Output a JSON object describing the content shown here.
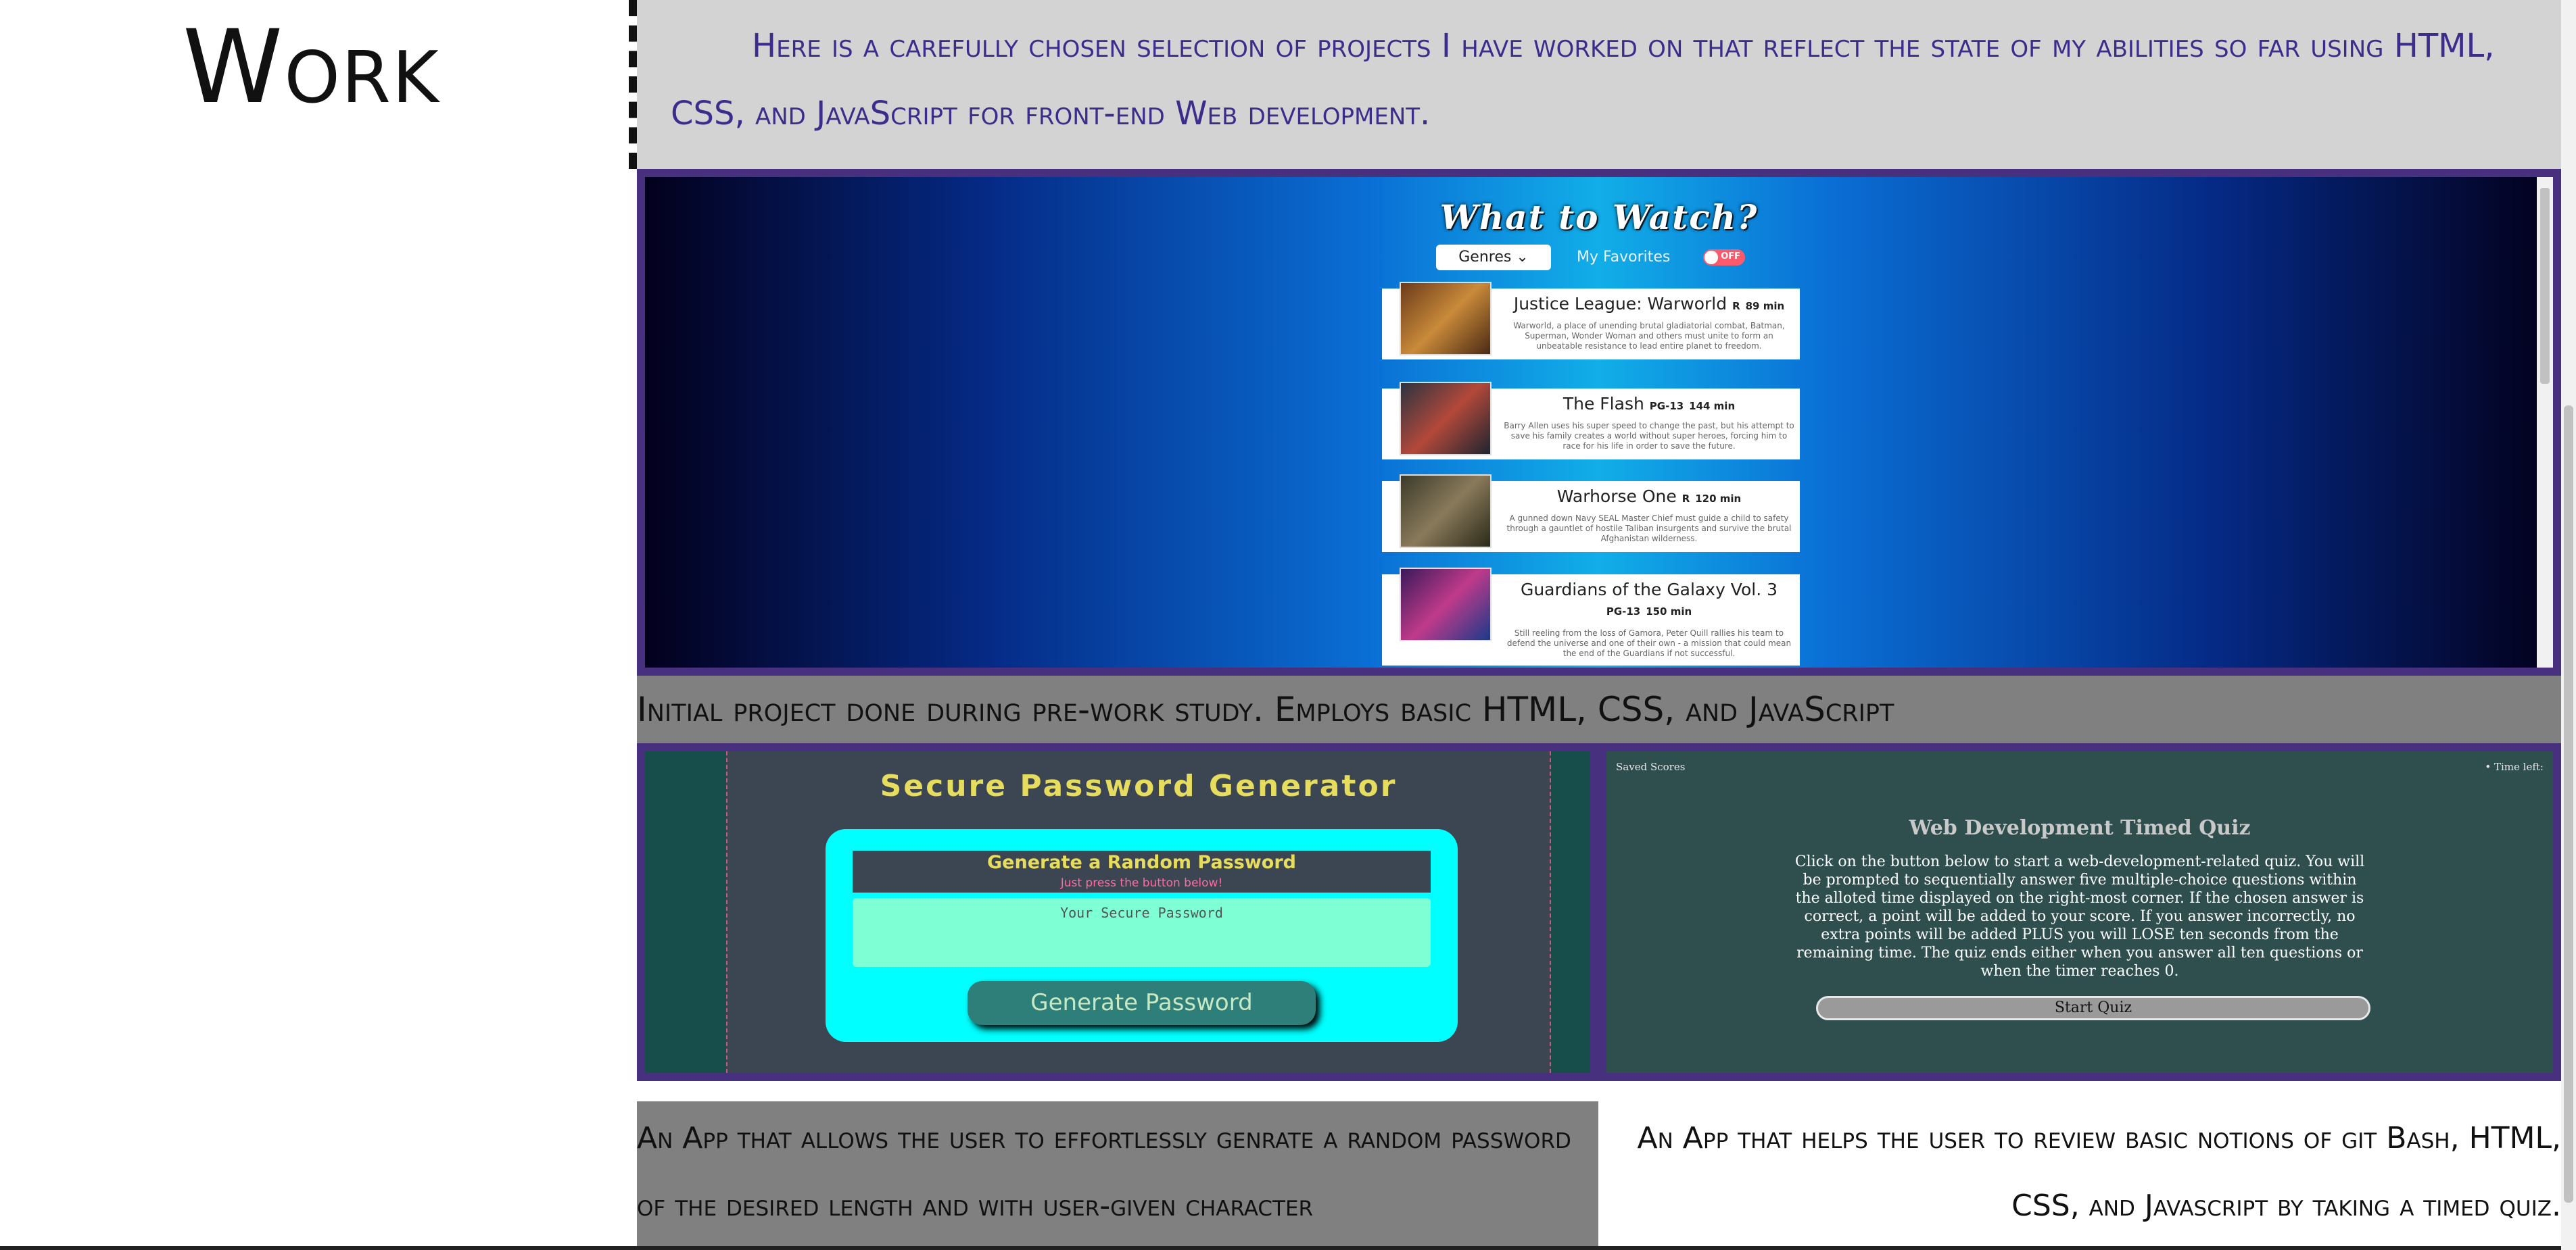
{
  "section": {
    "title": "Work"
  },
  "intro": {
    "text": "Here is a carefully chosen selection of projects I have worked on that reflect the state of my abilities so far using HTML, CSS, and JavaScript for front-end Web development."
  },
  "projects": {
    "watch": {
      "app_title": "What to Watch?",
      "genres_label": "Genres ⌄",
      "favorites_label": "My Favorites",
      "toggle_text": "OFF",
      "movies": [
        {
          "title": "Justice League: Warworld",
          "rating": "R",
          "runtime": "89 min",
          "description": "Warworld, a place of unending brutal gladiatorial combat, Batman, Superman, Wonder Woman and others must unite to form an unbeatable resistance to lead entire planet to freedom."
        },
        {
          "title": "The Flash",
          "rating": "PG-13",
          "runtime": "144 min",
          "description": "Barry Allen uses his super speed to change the past, but his attempt to save his family creates a world without super heroes, forcing him to race for his life in order to save the future."
        },
        {
          "title": "Warhorse One",
          "rating": "R",
          "runtime": "120 min",
          "description": "A gunned down Navy SEAL Master Chief must guide a child to safety through a gauntlet of hostile Taliban insurgents and survive the brutal Afghanistan wilderness."
        },
        {
          "title": "Guardians of the Galaxy Vol. 3",
          "rating": "PG-13",
          "runtime": "150 min",
          "description": "Still reeling from the loss of Gamora, Peter Quill rallies his team to defend the universe and one of their own - a mission that could mean the end of the Guardians if not successful."
        }
      ],
      "caption": "Initial project done during pre-work study. Employs basic HTML, CSS, and JavaScript"
    },
    "password": {
      "title": "Secure Password Generator",
      "card_heading": "Generate a Random Password",
      "card_sub": "Just press the button below!",
      "placeholder": "Your Secure Password",
      "button_label": "Generate Password",
      "caption": "An App that allows the user to effortlessly genrate a random password of the desired length and with user-given character"
    },
    "quiz": {
      "saved_scores": "Saved Scores",
      "time_left": "• Time left:",
      "title": "Web Development Timed Quiz",
      "description": "Click on the button below to start a web-development-related quiz. You will be prompted to sequentially answer five multiple-choice questions within the alloted time displayed on the right-most corner. If the chosen answer is correct, a point will be added to your score. If you answer incorrectly, no extra points will be added PLUS you will LOSE ten seconds from the remaining time. The quiz ends either when you answer all ten questions or when the timer reaches 0.",
      "start_label": "Start Quiz",
      "caption": "An App that helps the user to review basic notions of git Bash, HTML, CSS, and Javascript by taking a timed quiz."
    }
  },
  "colors": {
    "frame": "#47307e",
    "intro_text": "#3c2c8c",
    "intro_bg": "#d3d3d3",
    "caption_bg": "#808080"
  }
}
